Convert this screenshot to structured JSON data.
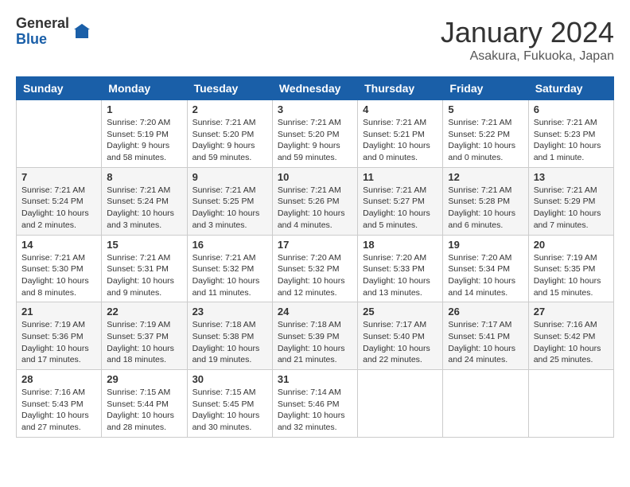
{
  "logo": {
    "general": "General",
    "blue": "Blue"
  },
  "header": {
    "month": "January 2024",
    "location": "Asakura, Fukuoka, Japan"
  },
  "weekdays": [
    "Sunday",
    "Monday",
    "Tuesday",
    "Wednesday",
    "Thursday",
    "Friday",
    "Saturday"
  ],
  "weeks": [
    [
      {
        "day": "",
        "info": ""
      },
      {
        "day": "1",
        "info": "Sunrise: 7:20 AM\nSunset: 5:19 PM\nDaylight: 9 hours\nand 58 minutes."
      },
      {
        "day": "2",
        "info": "Sunrise: 7:21 AM\nSunset: 5:20 PM\nDaylight: 9 hours\nand 59 minutes."
      },
      {
        "day": "3",
        "info": "Sunrise: 7:21 AM\nSunset: 5:20 PM\nDaylight: 9 hours\nand 59 minutes."
      },
      {
        "day": "4",
        "info": "Sunrise: 7:21 AM\nSunset: 5:21 PM\nDaylight: 10 hours\nand 0 minutes."
      },
      {
        "day": "5",
        "info": "Sunrise: 7:21 AM\nSunset: 5:22 PM\nDaylight: 10 hours\nand 0 minutes."
      },
      {
        "day": "6",
        "info": "Sunrise: 7:21 AM\nSunset: 5:23 PM\nDaylight: 10 hours\nand 1 minute."
      }
    ],
    [
      {
        "day": "7",
        "info": "Sunrise: 7:21 AM\nSunset: 5:24 PM\nDaylight: 10 hours\nand 2 minutes."
      },
      {
        "day": "8",
        "info": "Sunrise: 7:21 AM\nSunset: 5:24 PM\nDaylight: 10 hours\nand 3 minutes."
      },
      {
        "day": "9",
        "info": "Sunrise: 7:21 AM\nSunset: 5:25 PM\nDaylight: 10 hours\nand 3 minutes."
      },
      {
        "day": "10",
        "info": "Sunrise: 7:21 AM\nSunset: 5:26 PM\nDaylight: 10 hours\nand 4 minutes."
      },
      {
        "day": "11",
        "info": "Sunrise: 7:21 AM\nSunset: 5:27 PM\nDaylight: 10 hours\nand 5 minutes."
      },
      {
        "day": "12",
        "info": "Sunrise: 7:21 AM\nSunset: 5:28 PM\nDaylight: 10 hours\nand 6 minutes."
      },
      {
        "day": "13",
        "info": "Sunrise: 7:21 AM\nSunset: 5:29 PM\nDaylight: 10 hours\nand 7 minutes."
      }
    ],
    [
      {
        "day": "14",
        "info": "Sunrise: 7:21 AM\nSunset: 5:30 PM\nDaylight: 10 hours\nand 8 minutes."
      },
      {
        "day": "15",
        "info": "Sunrise: 7:21 AM\nSunset: 5:31 PM\nDaylight: 10 hours\nand 9 minutes."
      },
      {
        "day": "16",
        "info": "Sunrise: 7:21 AM\nSunset: 5:32 PM\nDaylight: 10 hours\nand 11 minutes."
      },
      {
        "day": "17",
        "info": "Sunrise: 7:20 AM\nSunset: 5:32 PM\nDaylight: 10 hours\nand 12 minutes."
      },
      {
        "day": "18",
        "info": "Sunrise: 7:20 AM\nSunset: 5:33 PM\nDaylight: 10 hours\nand 13 minutes."
      },
      {
        "day": "19",
        "info": "Sunrise: 7:20 AM\nSunset: 5:34 PM\nDaylight: 10 hours\nand 14 minutes."
      },
      {
        "day": "20",
        "info": "Sunrise: 7:19 AM\nSunset: 5:35 PM\nDaylight: 10 hours\nand 15 minutes."
      }
    ],
    [
      {
        "day": "21",
        "info": "Sunrise: 7:19 AM\nSunset: 5:36 PM\nDaylight: 10 hours\nand 17 minutes."
      },
      {
        "day": "22",
        "info": "Sunrise: 7:19 AM\nSunset: 5:37 PM\nDaylight: 10 hours\nand 18 minutes."
      },
      {
        "day": "23",
        "info": "Sunrise: 7:18 AM\nSunset: 5:38 PM\nDaylight: 10 hours\nand 19 minutes."
      },
      {
        "day": "24",
        "info": "Sunrise: 7:18 AM\nSunset: 5:39 PM\nDaylight: 10 hours\nand 21 minutes."
      },
      {
        "day": "25",
        "info": "Sunrise: 7:17 AM\nSunset: 5:40 PM\nDaylight: 10 hours\nand 22 minutes."
      },
      {
        "day": "26",
        "info": "Sunrise: 7:17 AM\nSunset: 5:41 PM\nDaylight: 10 hours\nand 24 minutes."
      },
      {
        "day": "27",
        "info": "Sunrise: 7:16 AM\nSunset: 5:42 PM\nDaylight: 10 hours\nand 25 minutes."
      }
    ],
    [
      {
        "day": "28",
        "info": "Sunrise: 7:16 AM\nSunset: 5:43 PM\nDaylight: 10 hours\nand 27 minutes."
      },
      {
        "day": "29",
        "info": "Sunrise: 7:15 AM\nSunset: 5:44 PM\nDaylight: 10 hours\nand 28 minutes."
      },
      {
        "day": "30",
        "info": "Sunrise: 7:15 AM\nSunset: 5:45 PM\nDaylight: 10 hours\nand 30 minutes."
      },
      {
        "day": "31",
        "info": "Sunrise: 7:14 AM\nSunset: 5:46 PM\nDaylight: 10 hours\nand 32 minutes."
      },
      {
        "day": "",
        "info": ""
      },
      {
        "day": "",
        "info": ""
      },
      {
        "day": "",
        "info": ""
      }
    ]
  ]
}
